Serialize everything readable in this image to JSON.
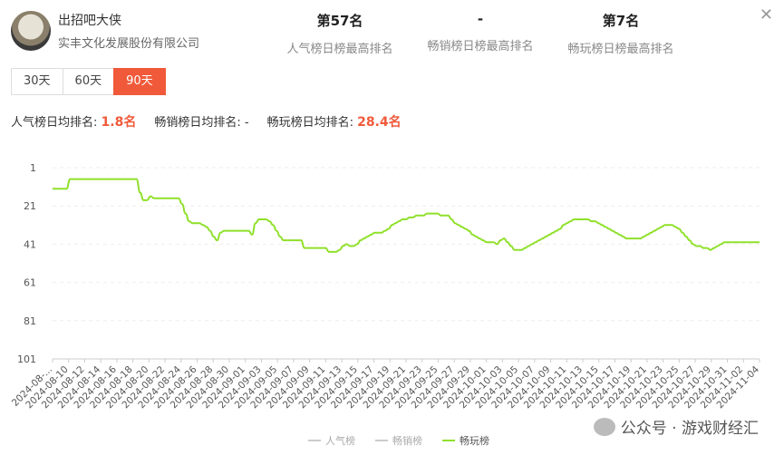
{
  "app": {
    "name": "出招吧大侠",
    "publisher": "实丰文化发展股份有限公司"
  },
  "ranks": [
    {
      "value": "第57名",
      "label": "人气榜日榜最高排名"
    },
    {
      "value": "-",
      "label": "畅销榜日榜最高排名"
    },
    {
      "value": "第7名",
      "label": "畅玩榜日榜最高排名"
    }
  ],
  "periods": [
    "30天",
    "60天",
    "90天"
  ],
  "active_period": "90天",
  "averages": [
    {
      "label": "人气榜日均排名:",
      "value": "1.8名"
    },
    {
      "label": "畅销榜日均排名:",
      "value": "-"
    },
    {
      "label": "畅玩榜日均排名:",
      "value": "28.4名"
    }
  ],
  "legend": [
    "人气榜",
    "畅销榜",
    "畅玩榜"
  ],
  "watermark": "公众号 · 游戏财经汇",
  "chart_data": {
    "type": "line",
    "y_reversed": true,
    "ylim": [
      1,
      101
    ],
    "yticks": [
      "1",
      "21",
      "41",
      "61",
      "81",
      "101"
    ],
    "xticks": [
      "2024-08-...",
      "2024-08-10",
      "2024-08-12",
      "2024-08-14",
      "2024-08-16",
      "2024-08-18",
      "2024-08-20",
      "2024-08-22",
      "2024-08-24",
      "2024-08-26",
      "2024-08-28",
      "2024-08-30",
      "2024-09-01",
      "2024-09-03",
      "2024-09-05",
      "2024-09-07",
      "2024-09-09",
      "2024-09-11",
      "2024-09-13",
      "2024-09-15",
      "2024-09-17",
      "2024-09-19",
      "2024-09-21",
      "2024-09-23",
      "2024-09-25",
      "2024-09-27",
      "2024-09-29",
      "2024-10-01",
      "2024-10-03",
      "2024-10-05",
      "2024-10-07",
      "2024-10-09",
      "2024-10-11",
      "2024-10-13",
      "2024-10-15",
      "2024-10-17",
      "2024-10-19",
      "2024-10-21",
      "2024-10-23",
      "2024-10-25",
      "2024-10-27",
      "2024-10-29",
      "2024-10-31",
      "2024-11-02",
      "2024-11-04"
    ],
    "series": [
      {
        "name": "畅玩榜",
        "color": "#8fe02a",
        "values": [
          12,
          12,
          12,
          12,
          12,
          7,
          7,
          7,
          7,
          7,
          7,
          7,
          7,
          7,
          7,
          7,
          7,
          7,
          7,
          7,
          7,
          7,
          7,
          7,
          7,
          14,
          18,
          18,
          16,
          17,
          17,
          17,
          17,
          17,
          17,
          17,
          17,
          20,
          25,
          29,
          30,
          30,
          30,
          31,
          32,
          34,
          37,
          39,
          35,
          34,
          34,
          34,
          34,
          34,
          34,
          34,
          34,
          36,
          30,
          28,
          28,
          28,
          29,
          31,
          34,
          37,
          39,
          39,
          39,
          39,
          39,
          39,
          43,
          43,
          43,
          43,
          43,
          43,
          43,
          45,
          45,
          45,
          44,
          42,
          41,
          42,
          42,
          41,
          39,
          38,
          37,
          36,
          35,
          35,
          35,
          34,
          33,
          31,
          30,
          29,
          28,
          28,
          27,
          27,
          26,
          26,
          26,
          25,
          25,
          25,
          25,
          26,
          26,
          26,
          28,
          30,
          31,
          32,
          33,
          34,
          36,
          37,
          38,
          39,
          40,
          40,
          40,
          41,
          39,
          38,
          40,
          42,
          44,
          44,
          44,
          43,
          42,
          41,
          40,
          39,
          38,
          37,
          36,
          35,
          34,
          33,
          31,
          30,
          29,
          28,
          28,
          28,
          28,
          28,
          29,
          29,
          30,
          31,
          32,
          33,
          34,
          35,
          36,
          37,
          38,
          38,
          38,
          38,
          38,
          37,
          36,
          35,
          34,
          33,
          32,
          31,
          31,
          31,
          32,
          33,
          35,
          37,
          39,
          41,
          42,
          42,
          43,
          43,
          44,
          43,
          42,
          41,
          40,
          40,
          40,
          40,
          40,
          40,
          40,
          40,
          40,
          40,
          40
        ]
      }
    ]
  }
}
